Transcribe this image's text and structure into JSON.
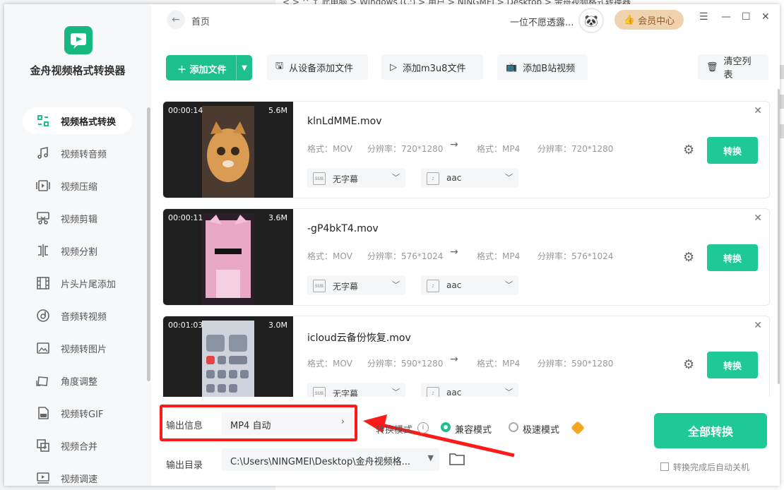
{
  "explorer": {
    "path": "< > ^ ↑  此电脑 > Windows (C:) > 用户 > NINGMEI > Desktop > 金舟视频格式转换器"
  },
  "app": {
    "name": "金舟视频格式转换器",
    "accent": "#1dbf8c"
  },
  "sidebar": {
    "items": [
      {
        "label": "视频格式转换",
        "icon": "convert-icon",
        "active": true
      },
      {
        "label": "视频转音频",
        "icon": "music-icon"
      },
      {
        "label": "视频压缩",
        "icon": "compress-icon"
      },
      {
        "label": "视频剪辑",
        "icon": "scissors-icon"
      },
      {
        "label": "视频分割",
        "icon": "split-icon"
      },
      {
        "label": "片头片尾添加",
        "icon": "film-icon"
      },
      {
        "label": "音频转视频",
        "icon": "disc-icon"
      },
      {
        "label": "视频转图片",
        "icon": "image-icon"
      },
      {
        "label": "角度调整",
        "icon": "rotate-icon"
      },
      {
        "label": "视频转GIF",
        "icon": "gif-icon"
      },
      {
        "label": "视频合并",
        "icon": "merge-icon"
      },
      {
        "label": "视频调速",
        "icon": "speed-icon"
      }
    ]
  },
  "header": {
    "breadcrumb": "首页",
    "username": "一位不愿透露...",
    "vip": "会员中心"
  },
  "toolbar": {
    "add_file": "添加文件",
    "add_device": "从设备添加文件",
    "add_m3u8": "添加m3u8文件",
    "add_bili": "添加B站视频",
    "clear": "清空列表"
  },
  "files": [
    {
      "name": "klnLdMME.mov",
      "duration": "00:00:14",
      "size": "5.6M",
      "in_format": "格式：MOV",
      "in_res": "分辨率：720*1280",
      "out_format": "格式：MP4",
      "out_res": "分辨率：720*1280",
      "subtitle": "无字幕",
      "audio": "aac",
      "convert": "转换"
    },
    {
      "name": "-gP4bkT4.mov",
      "duration": "00:00:11",
      "size": "3.6M",
      "in_format": "格式：MOV",
      "in_res": "分辨率：576*1024",
      "out_format": "格式：MP4",
      "out_res": "分辨率：576*1024",
      "subtitle": "无字幕",
      "audio": "aac",
      "convert": "转换"
    },
    {
      "name": "icloud云备份恢复.mov",
      "duration": "00:01:03",
      "size": "3.0M",
      "in_format": "格式：MOV",
      "in_res": "分辨率：590*1280",
      "out_format": "格式：MP4",
      "out_res": "分辨率：590*1280",
      "subtitle": "无字幕",
      "audio": "aac",
      "convert": "转换"
    }
  ],
  "bottom": {
    "output_info_label": "输出信息",
    "output_info_value": "MP4 自动",
    "mode_label": "转换模式",
    "mode_compat": "兼容模式",
    "mode_fast": "极速模式",
    "output_dir_label": "输出目录",
    "output_dir_value": "C:\\Users\\NINGMEI\\Desktop\\金舟视频格...",
    "convert_all": "全部转换",
    "auto_shutdown": "转换完成后自动关机"
  }
}
